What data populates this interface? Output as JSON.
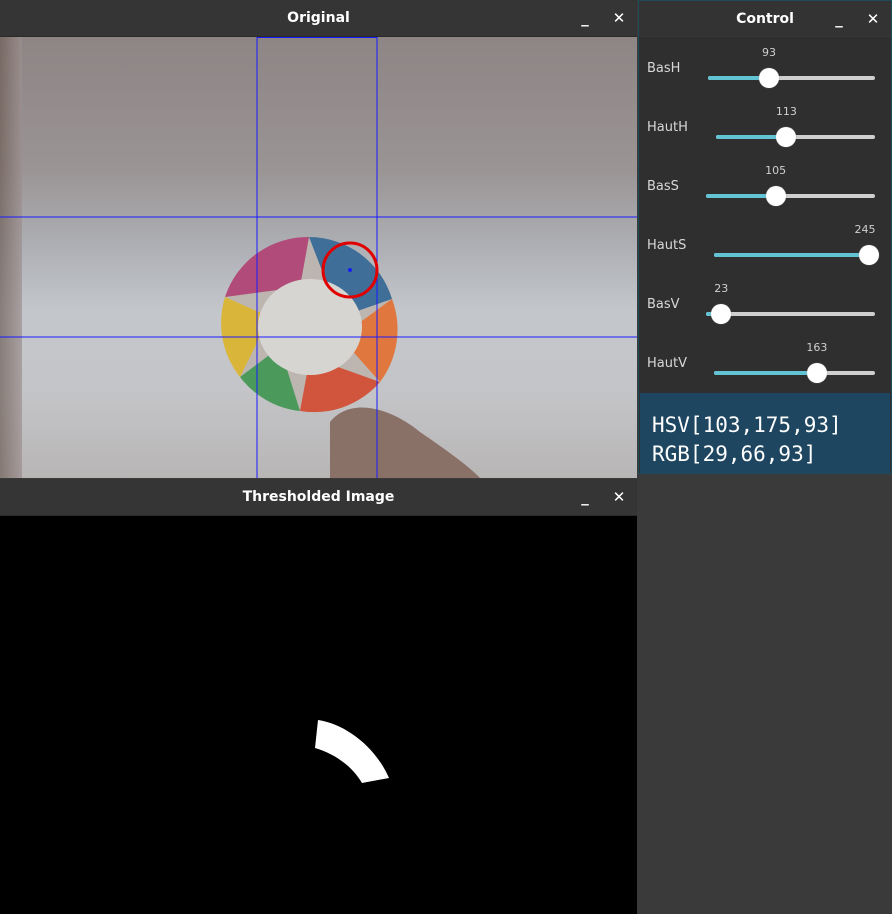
{
  "windows": {
    "original": {
      "title": "Original"
    },
    "thresholded": {
      "title": "Thresholded Image"
    },
    "control": {
      "title": "Control"
    }
  },
  "titlebar_buttons": {
    "minimize": "_",
    "close": "✕"
  },
  "sliders": [
    {
      "label": "BasH",
      "value": "93",
      "fraction": 0.365
    },
    {
      "label": "HautH",
      "value": "113",
      "fraction": 0.443
    },
    {
      "label": "BasS",
      "value": "105",
      "fraction": 0.412
    },
    {
      "label": "HautS",
      "value": "245",
      "fraction": 0.961
    },
    {
      "label": "BasV",
      "value": "23",
      "fraction": 0.09
    },
    {
      "label": "HautV",
      "value": "163",
      "fraction": 0.639
    }
  ],
  "readout": {
    "hsv": "HSV[103,175,93]",
    "rgb": "RGB[29,66,93]"
  },
  "colors": {
    "slider_fill": "#62c3d4",
    "readout_bg": "#1e4660",
    "grid_lines": "#1a1aff",
    "marker": "#e00000"
  },
  "icons": {
    "minimize": "minimize-icon",
    "close": "close-icon"
  }
}
